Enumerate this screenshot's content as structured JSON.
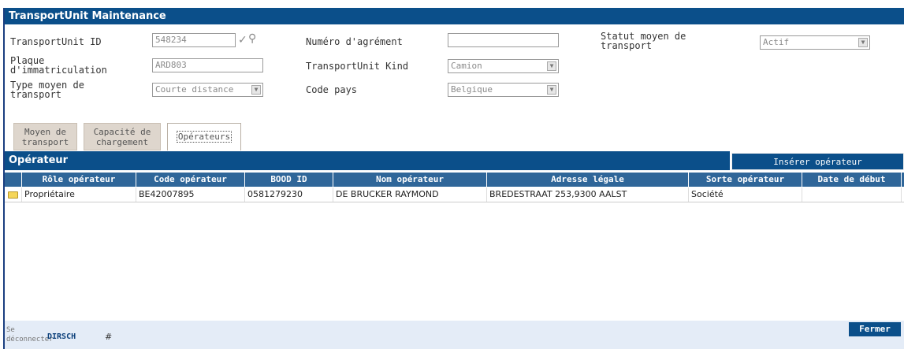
{
  "window": {
    "title": "TransportUnit Maintenance"
  },
  "form": {
    "transportunit_id": {
      "label": "TransportUnit ID",
      "value": "548234"
    },
    "numero_agrement": {
      "label": "Numéro d'agrément",
      "value": ""
    },
    "statut": {
      "label": "Statut moyen de transport",
      "value": "Actif"
    },
    "plaque": {
      "label": "Plaque d'immatriculation",
      "value": "ARD803"
    },
    "kind": {
      "label": "TransportUnit Kind",
      "value": "Camion"
    },
    "type_moyen": {
      "label": "Type moyen de transport",
      "value": "Courte distance"
    },
    "code_pays": {
      "label": "Code pays",
      "value": "Belgique"
    }
  },
  "tabs": [
    {
      "label": "Moyen de transport",
      "active": false
    },
    {
      "label": "Capacité de chargement",
      "active": false
    },
    {
      "label": "Opérateurs",
      "active": true
    }
  ],
  "section": {
    "title": "Opérateur",
    "insert_label": "Insérer opérateur"
  },
  "table": {
    "headers": [
      "Rôle opérateur",
      "Code opérateur",
      "BOOD ID",
      "Nom opérateur",
      "Adresse légale",
      "Sorte opérateur",
      "Date de début"
    ],
    "rows": [
      [
        "Propriétaire",
        "BE42007895",
        "0581279230",
        "DE BRUCKER RAYMOND",
        "BREDESTRAAT 253,9300 AALST",
        "Société",
        ""
      ]
    ]
  },
  "footer": {
    "logout_label": "Se déconnecter",
    "user": "DIRSCH",
    "hash": "#",
    "close_label": "Fermer"
  },
  "colors": {
    "header_bg": "#0b4f8a",
    "grid_head_bg": "#2f6699",
    "footer_bg": "#e4ecf7"
  }
}
